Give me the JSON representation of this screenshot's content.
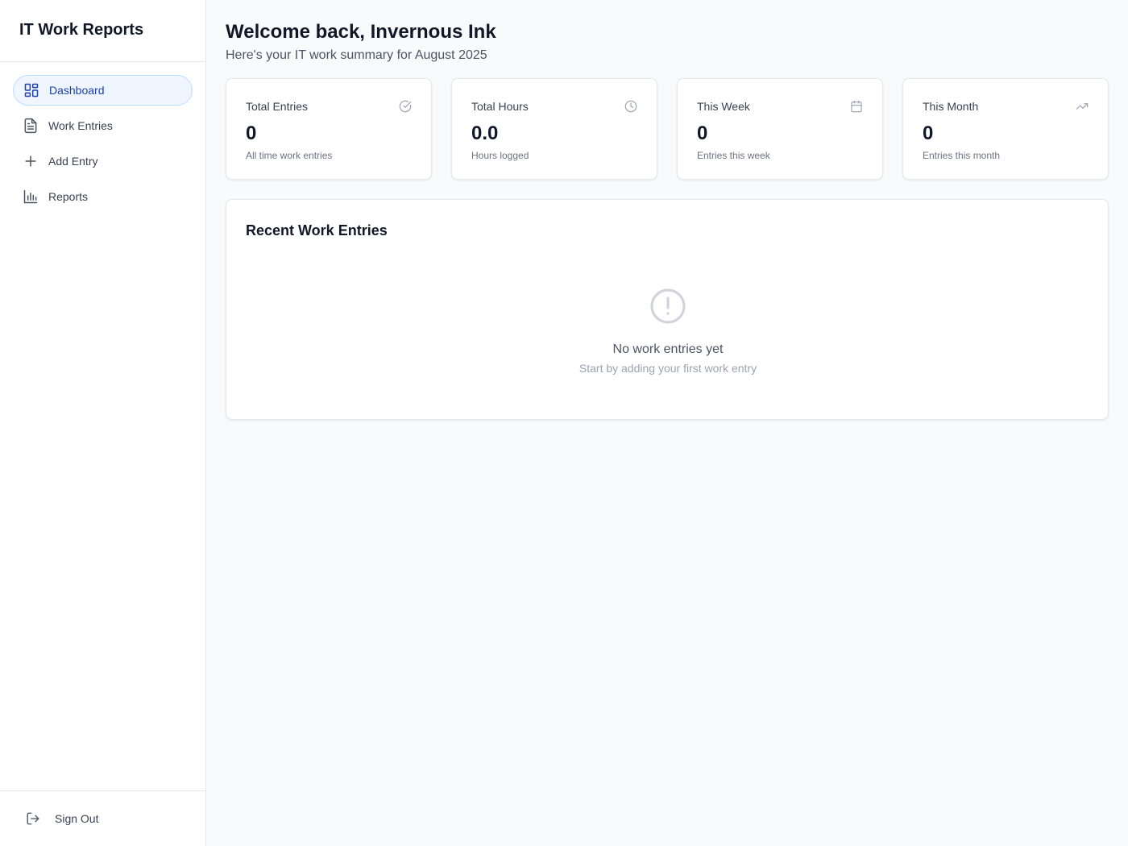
{
  "app": {
    "title": "IT Work Reports"
  },
  "sidebar": {
    "items": [
      {
        "label": "Dashboard",
        "icon": "dashboard-icon",
        "active": true
      },
      {
        "label": "Work Entries",
        "icon": "file-text-icon"
      },
      {
        "label": "Add Entry",
        "icon": "plus-icon"
      },
      {
        "label": "Reports",
        "icon": "bar-chart-icon"
      }
    ],
    "signout_label": "Sign Out"
  },
  "header": {
    "welcome": "Welcome back, Invernous Ink",
    "subtitle": "Here's your IT work summary for August 2025"
  },
  "stats": [
    {
      "title": "Total Entries",
      "value": "0",
      "desc": "All time work entries",
      "icon": "check-circle-icon"
    },
    {
      "title": "Total Hours",
      "value": "0.0",
      "desc": "Hours logged",
      "icon": "clock-icon"
    },
    {
      "title": "This Week",
      "value": "0",
      "desc": "Entries this week",
      "icon": "calendar-icon"
    },
    {
      "title": "This Month",
      "value": "0",
      "desc": "Entries this month",
      "icon": "trending-up-icon"
    }
  ],
  "recent": {
    "title": "Recent Work Entries",
    "empty_title": "No work entries yet",
    "empty_sub": "Start by adding your first work entry"
  },
  "colors": {
    "accent": "#1e40af",
    "active_bg": "#eff6ff",
    "muted_icon": "#9ca3af"
  }
}
